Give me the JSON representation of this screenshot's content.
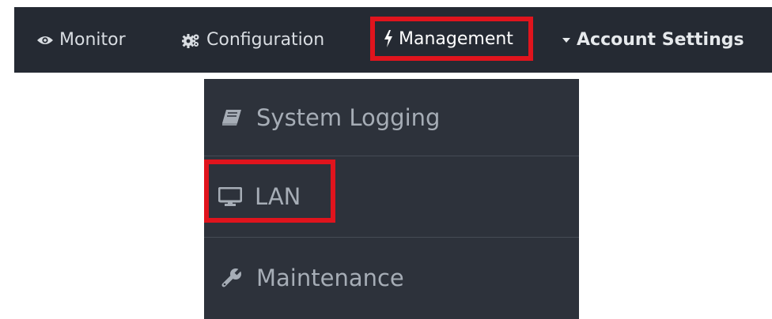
{
  "navbar": {
    "items": [
      {
        "label": "Monitor",
        "icon": "eye-icon"
      },
      {
        "label": "Configuration",
        "icon": "gears-icon"
      },
      {
        "label": "Management",
        "icon": "bolt-icon",
        "highlighted": true
      },
      {
        "label": "Account Settings",
        "icon": "caret-down-icon"
      }
    ]
  },
  "dropdown": {
    "items": [
      {
        "label": "System Logging",
        "icon": "book-icon"
      },
      {
        "label": "LAN",
        "icon": "monitor-icon",
        "highlighted": true
      },
      {
        "label": "Maintenance",
        "icon": "wrench-icon"
      }
    ]
  },
  "colors": {
    "navbar_bg": "#252a33",
    "dropdown_bg": "#2d323b",
    "highlight": "#e0141d",
    "nav_text": "#d9dde2",
    "dropdown_text": "#a6adb6"
  }
}
